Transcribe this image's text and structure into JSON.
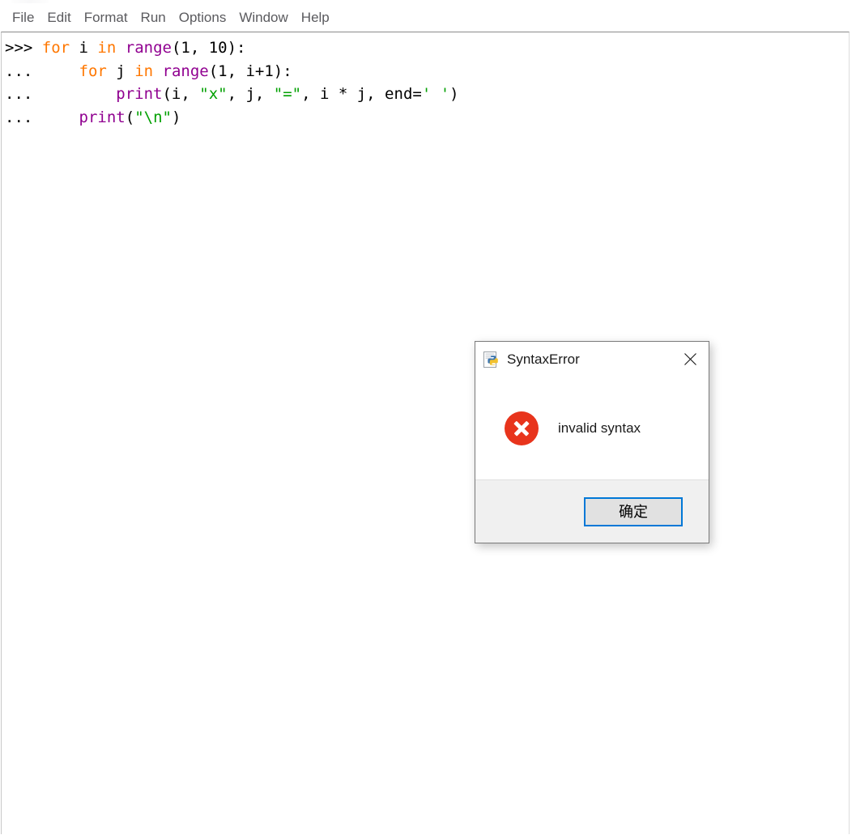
{
  "window": {
    "app": "Python IDLE Shell",
    "title_sliver_visible": true
  },
  "menubar": {
    "items": [
      {
        "label": "File",
        "name": "menu-file"
      },
      {
        "label": "Edit",
        "name": "menu-edit"
      },
      {
        "label": "Format",
        "name": "menu-format"
      },
      {
        "label": "Run",
        "name": "menu-run"
      },
      {
        "label": "Options",
        "name": "menu-options"
      },
      {
        "label": "Window",
        "name": "menu-window"
      },
      {
        "label": "Help",
        "name": "menu-help"
      }
    ]
  },
  "shell": {
    "prompt_primary": ">>> ",
    "prompt_continuation": "... ",
    "lines": [
      {
        "prompt": ">>> ",
        "segments": [
          {
            "text": "for",
            "type": "keyword"
          },
          {
            "text": " i ",
            "type": "plain"
          },
          {
            "text": "in",
            "type": "keyword"
          },
          {
            "text": " ",
            "type": "plain"
          },
          {
            "text": "range",
            "type": "builtin"
          },
          {
            "text": "(1, 10):",
            "type": "plain"
          }
        ]
      },
      {
        "prompt": "... ",
        "segments": [
          {
            "text": "    ",
            "type": "plain"
          },
          {
            "text": "for",
            "type": "keyword"
          },
          {
            "text": " j ",
            "type": "plain"
          },
          {
            "text": "in",
            "type": "keyword"
          },
          {
            "text": " ",
            "type": "plain"
          },
          {
            "text": "range",
            "type": "builtin"
          },
          {
            "text": "(1, i+1):",
            "type": "plain"
          }
        ]
      },
      {
        "prompt": "... ",
        "segments": [
          {
            "text": "        ",
            "type": "plain"
          },
          {
            "text": "print",
            "type": "builtin"
          },
          {
            "text": "(i, ",
            "type": "plain"
          },
          {
            "text": "\"x\"",
            "type": "string"
          },
          {
            "text": ", j, ",
            "type": "plain"
          },
          {
            "text": "\"=\"",
            "type": "string"
          },
          {
            "text": ", i * j, end=",
            "type": "plain"
          },
          {
            "text": "' '",
            "type": "string"
          },
          {
            "text": ")",
            "type": "plain"
          }
        ]
      },
      {
        "prompt": "... ",
        "segments": [
          {
            "text": "    ",
            "type": "plain"
          },
          {
            "text": "print",
            "type": "builtin"
          },
          {
            "text": "(",
            "type": "plain"
          },
          {
            "text": "\"\\n\"",
            "type": "string"
          },
          {
            "text": ")",
            "type": "plain"
          }
        ]
      }
    ],
    "full_text": ">>> for i in range(1, 10):\n...     for j in range(1, i+1):\n...         print(i, \"x\", j, \"=\", i * j, end=' ')\n...     print(\"\\n\")"
  },
  "dialog": {
    "title": "SyntaxError",
    "icon": "python-document-icon",
    "close_label": "✕",
    "message": "invalid syntax",
    "message_icon": "error-cross-icon",
    "ok_label": "确定"
  },
  "colors": {
    "keyword": "#ff7700",
    "builtin": "#900090",
    "string": "#00a000",
    "plain": "#000000",
    "menu_text": "#5a5a5e",
    "error_red": "#e8341c",
    "focus_blue": "#0078d7",
    "footer_gray": "#f0f0f0"
  }
}
